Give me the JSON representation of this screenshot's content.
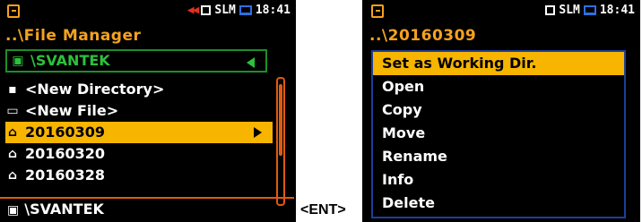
{
  "left_screen": {
    "status": {
      "indicator": "SLM",
      "time": "18:41"
    },
    "title": "..\\File Manager",
    "drive": {
      "label": "\\SVANTEK"
    },
    "items": [
      {
        "icon": "save-icon",
        "label": "<New Directory>"
      },
      {
        "icon": "file-icon",
        "label": "<New File>"
      },
      {
        "icon": "folder-icon",
        "label": "20160309",
        "selected": true
      },
      {
        "icon": "folder-icon",
        "label": "20160320"
      },
      {
        "icon": "folder-icon",
        "label": "20160328"
      }
    ],
    "footer": "\\SVANTEK"
  },
  "between_label": "<ENT>",
  "right_screen": {
    "status": {
      "indicator": "SLM",
      "time": "18:41"
    },
    "title": "..\\20160309",
    "menu": [
      "Set as Working Dir.",
      "Open",
      "Copy",
      "Move",
      "Rename",
      "Info",
      "Delete"
    ]
  },
  "colors": {
    "accent_orange": "#f5a21e",
    "selection": "#f7b500",
    "green": "#2bc23a",
    "scroll": "#e05a10",
    "blue": "#2f6fe0"
  }
}
